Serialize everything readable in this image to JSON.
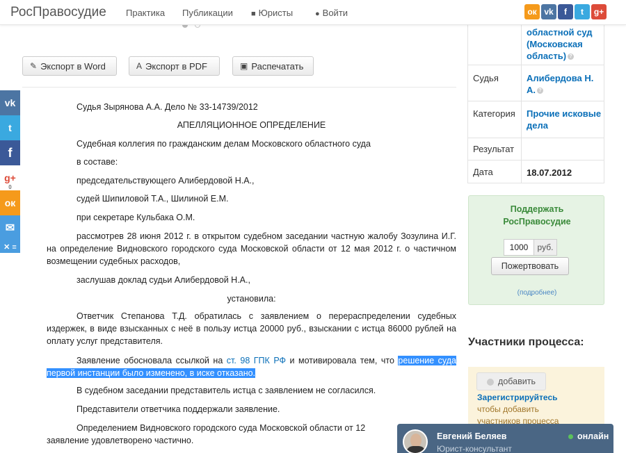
{
  "brand": "РосПравосудие",
  "nav": {
    "practice": "Практика",
    "publications": "Публикации",
    "lawyers": "Юристы",
    "login": "Войти"
  },
  "toolbar": {
    "export_word": "Экспорт в Word",
    "export_pdf": "Экспорт в PDF",
    "print": "Распечатать"
  },
  "share_counts": {
    "google_plus": "0"
  },
  "document": {
    "header": "Судья Зырянова А.А. Дело № 33-14739/2012",
    "title": "АПЕЛЛЯЦИОННОЕ ОПРЕДЕЛЕНИЕ",
    "p1": "Судебная коллегия по гражданским делам Московского областного суда",
    "p2": "в составе:",
    "p3": "председательствующего Алибердовой Н.А.,",
    "p4": "судей Шипиловой Т.А., Шилиной Е.М.",
    "p5": "при секретаре Кульбака О.М.",
    "p6": "рассмотрев 28 июня 2012 г. в открытом судебном заседании частную жалобу Зозулина И.Г. на определение Видновского городского суда Московской области от 12 мая 2012 г. о частичном возмещении судебных расходов,",
    "p7": "заслушав доклад судьи Алибердовой Н.А.,",
    "p8": "установила:",
    "p9": "Ответчик Степанова Т.Д. обратилась с заявлением о перераспределении судебных издержек, в виде взысканных с неё в пользу истца 20000 руб., взыскании с истца 86000 рублей на оплату услуг представителя.",
    "p10_start": "Заявление обосновала ссылкой на ",
    "p10_link": "ст. 98 ГПК РФ",
    "p10_mid": " и мотивировала тем, что ",
    "p10_hl1": "решение суда",
    "p10_hl2": "первой инстанции было изменено, в иске отказано.",
    "p11": "В судебном заседании представитель истца с заявлением не согласился.",
    "p12": "Представители ответчика поддержали заявление.",
    "p13": "Определением Видновского городского суда Московской области от 12",
    "p13b": "заявление удовлетворено частично."
  },
  "info": {
    "court_value": "областной суд (Московская область)",
    "judge_label": "Судья",
    "judge_value": "Алибердова Н. А.",
    "category_label": "Категория",
    "category_value": "Прочие исковые дела",
    "result_label": "Результат",
    "result_value": "",
    "date_label": "Дата",
    "date_value": "18.07.2012"
  },
  "donate": {
    "title": "Поддержать РосПравосудие",
    "amount": "1000",
    "currency": "руб.",
    "button": "Пожертвовать",
    "more": "(подробнее)"
  },
  "participants": {
    "heading": "Участники процесса:",
    "add_button": "добавить",
    "register_link": "Зарегистрируйтесь",
    "register_text1": "чтобы добавить",
    "register_text2": "участников процесса"
  },
  "chat": {
    "name": "Евгений Беляев",
    "role": "Юрист-консультант",
    "status": "онлайн"
  },
  "colors": {
    "link": "#0a6fb8",
    "highlight": "#3390ff",
    "donate_bg": "#e6f3e4",
    "chat_bg": "#4a6684"
  }
}
